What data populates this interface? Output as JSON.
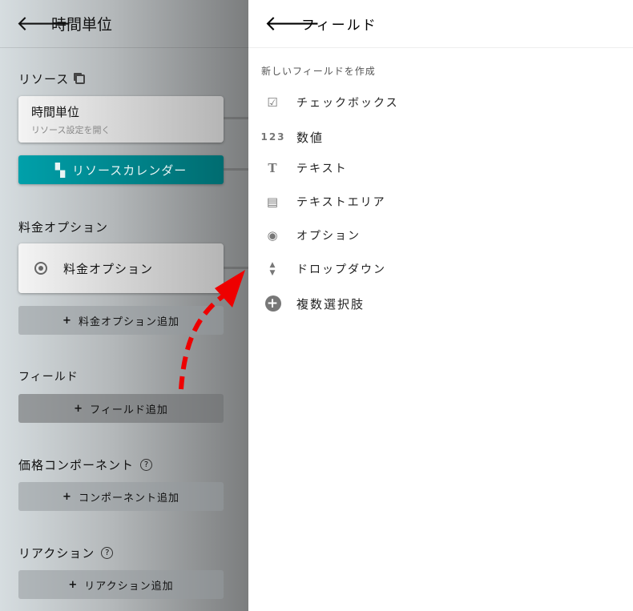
{
  "left": {
    "title": "時間単位",
    "resource_label": "リソース",
    "resource_card": {
      "title": "時間単位",
      "subtitle": "リソース設定を開く"
    },
    "calendar_button": "リソースカレンダー",
    "pricing_label": "料金オプション",
    "pricing_card": "料金オプション",
    "add_pricing": "料金オプション追加",
    "fields_label": "フィールド",
    "add_field": "フィールド追加",
    "price_component_label": "価格コンポーネント",
    "add_component": "コンポーネント追加",
    "reaction_label": "リアクション",
    "add_reaction": "リアクション追加"
  },
  "right": {
    "title": "フィールド",
    "subtitle": "新しいフィールドを作成",
    "items": [
      {
        "label": "チェックボックス",
        "icon": "checkbox-icon"
      },
      {
        "label": "数値",
        "icon": "numeric-icon"
      },
      {
        "label": "テキスト",
        "icon": "text-icon"
      },
      {
        "label": "テキストエリア",
        "icon": "textarea-icon"
      },
      {
        "label": "オプション",
        "icon": "radio-icon"
      },
      {
        "label": "ドロップダウン",
        "icon": "dropdown-icon"
      },
      {
        "label": "複数選択肢",
        "icon": "plus-circle-icon"
      }
    ]
  },
  "colors": {
    "teal": "#00959f",
    "arrow": "#ee0000"
  }
}
